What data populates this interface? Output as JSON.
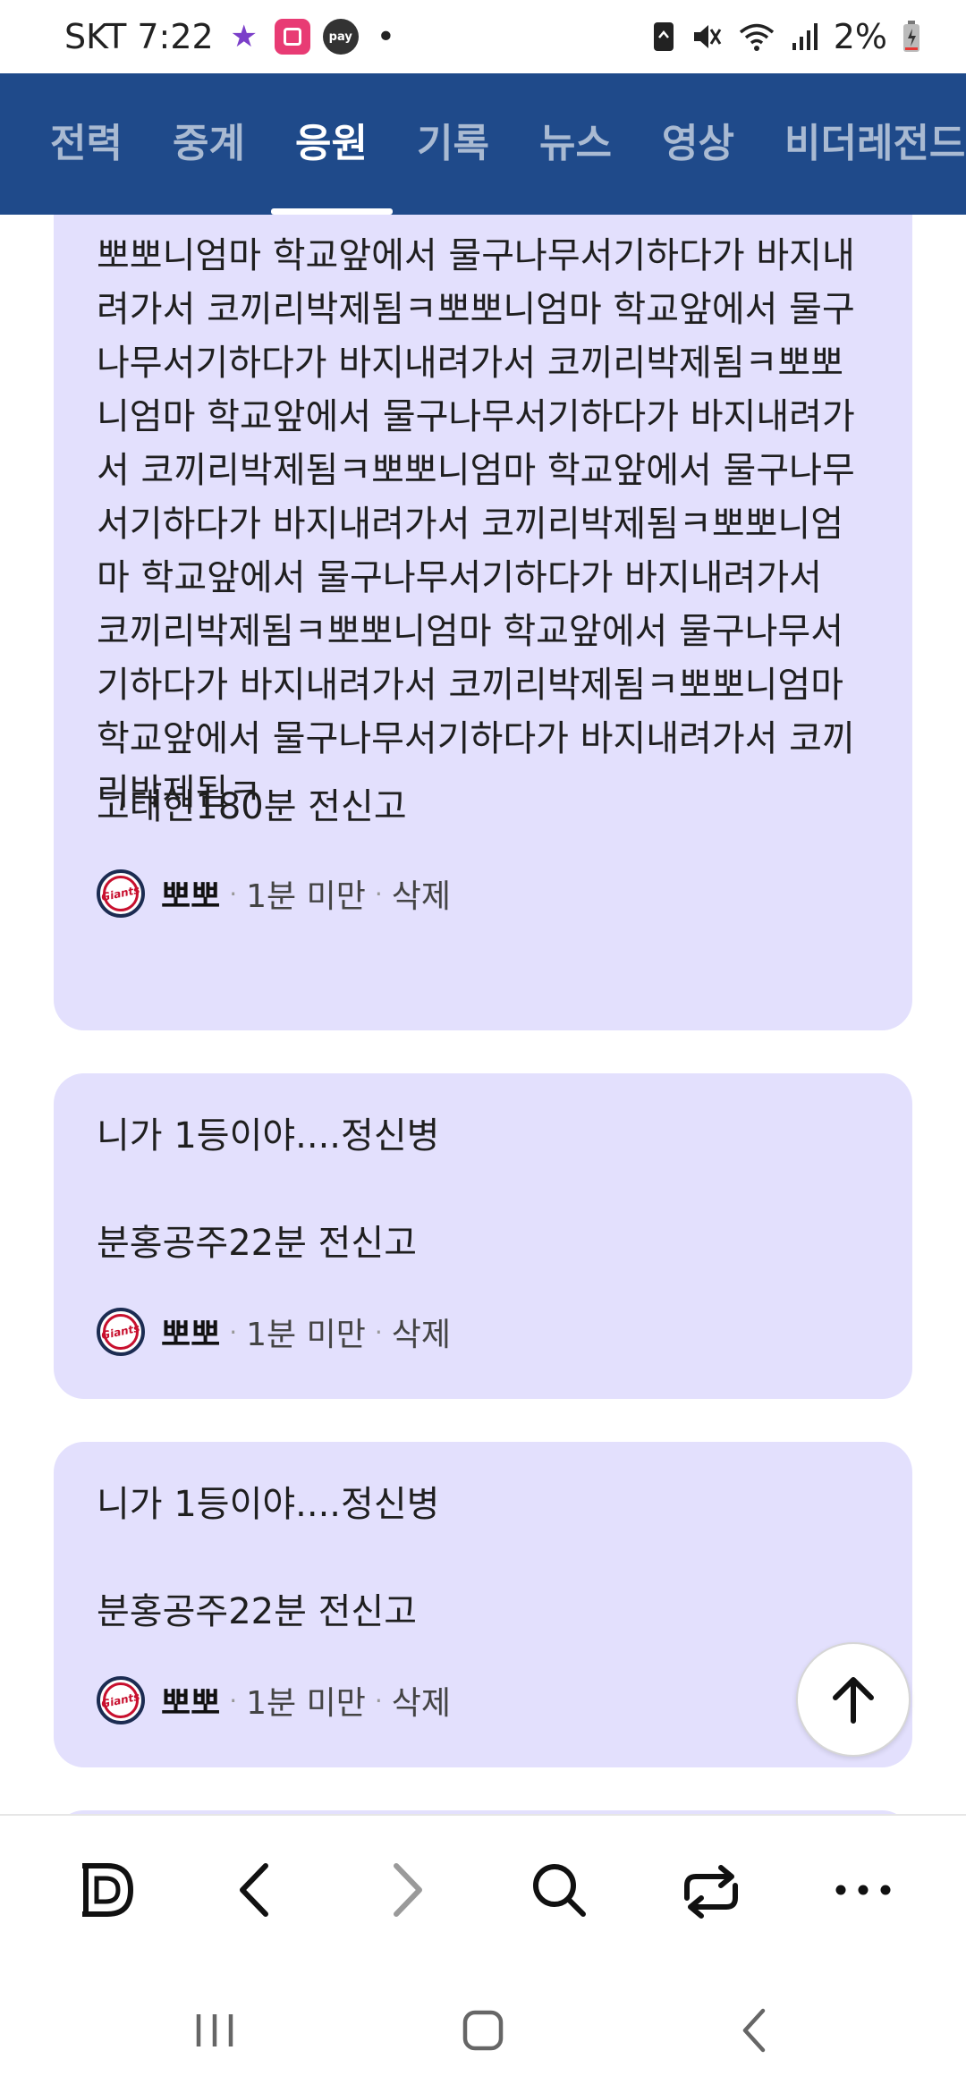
{
  "status_bar": {
    "carrier_time": "SKT 7:22",
    "pay_label": "pay",
    "battery": "2%"
  },
  "tabs": [
    {
      "label": "전력"
    },
    {
      "label": "중계"
    },
    {
      "label": "응원",
      "active": true
    },
    {
      "label": "기록"
    },
    {
      "label": "뉴스"
    },
    {
      "label": "영상"
    },
    {
      "label": "비더레전드"
    }
  ],
  "posts": [
    {
      "text": "뽀뽀니엄마 학교앞에서 물구나무서기하다가 바지내려가서 코끼리박제됨ㅋ뽀뽀니엄마 학교앞에서 물구나무서기하다가 바지내려가서 코끼리박제됨ㅋ뽀뽀니엄마 학교앞에서 물구나무서기하다가 바지내려가서 코끼리박제됨ㅋ뽀뽀니엄마 학교앞에서 물구나무서기하다가 바지내려가서 코끼리박제됨ㅋ뽀뽀니엄마 학교앞에서 물구나무서기하다가 바지내려가서 코끼리박제됨ㅋ뽀뽀니엄마 학교앞에서 물구나무서기하다가 바지내려가서 코끼리박제됨ㅋ뽀뽀니엄마 학교앞에서 물구나무서기하다가 바지내려가서 코끼리박제됨ㅋ",
      "signature": "고태현180분 전신고",
      "author": "뽀뽀",
      "time": "1분 미만",
      "delete": "삭제",
      "logo_text": "Giants"
    },
    {
      "text": "니가 1등이야....정신병",
      "signature": "분홍공주22분 전신고",
      "author": "뽀뽀",
      "time": "1분 미만",
      "delete": "삭제",
      "logo_text": "Giants"
    },
    {
      "text": "니가 1등이야....정신병",
      "signature": "분홍공주22분 전신고",
      "author": "뽀뽀",
      "time": "1분 미만",
      "delete": "삭제",
      "logo_text": "Giants"
    }
  ],
  "colors": {
    "nav_bg": "#1f4a8a",
    "card_bg": "#e3e0fd",
    "team_red": "#c8102e"
  },
  "toolbar_icons": [
    "d-home-icon",
    "back-icon",
    "forward-icon",
    "search-icon",
    "tabs-switch-icon",
    "more-icon"
  ],
  "system_nav_icons": [
    "recents-icon",
    "home-icon",
    "back-icon"
  ]
}
